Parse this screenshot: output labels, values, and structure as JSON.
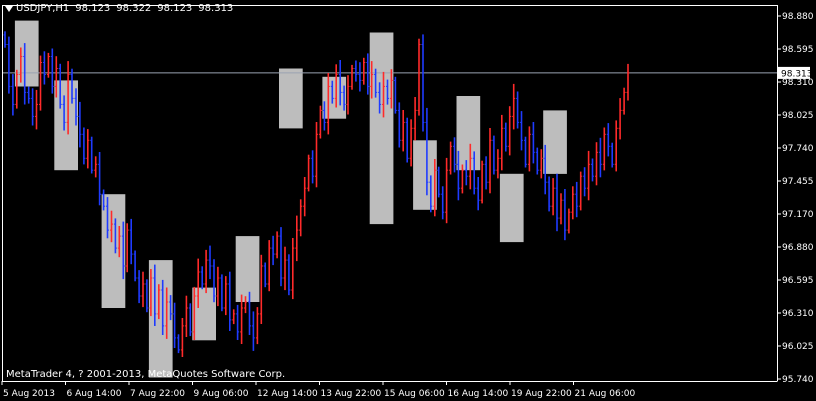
{
  "header": {
    "symbol": "USDJPY,H1",
    "open": "98.123",
    "high": "98.322",
    "low": "98.123",
    "close": "98.313"
  },
  "copyright": "MetaTrader 4, ? 2001-2013, MetaQuotes Software Corp.",
  "colors": {
    "background": "#000000",
    "axis": "#ffffff",
    "bull": "#ff2a2a",
    "bear": "#1f3bff",
    "highlight_box": "#bdbdbd",
    "bid_line": "#9aa3b2",
    "price_tag_bg": "#ffffff"
  },
  "chart_data": {
    "type": "bar",
    "symbol": "USDJPY",
    "timeframe": "H1",
    "ylim": [
      95.74,
      98.88
    ],
    "y_ticks": [
      "98.880",
      "98.595",
      "98.310",
      "98.025",
      "97.740",
      "97.455",
      "97.170",
      "96.880",
      "96.595",
      "96.310",
      "96.025",
      "95.740"
    ],
    "x_ticks": [
      "5 Aug 2013",
      "6 Aug 14:00",
      "7 Aug 22:00",
      "9 Aug 06:00",
      "12 Aug 14:00",
      "13 Aug 22:00",
      "15 Aug 06:00",
      "16 Aug 14:00",
      "19 Aug 22:00",
      "21 Aug 06:00"
    ],
    "current_price": "98.313",
    "closes": [
      98.55,
      98.2,
      98.05,
      98.3,
      98.45,
      98.15,
      98.1,
      97.95,
      98.05,
      98.4,
      98.3,
      98.45,
      98.2,
      98.35,
      98.05,
      97.9,
      98.3,
      98.1,
      97.95,
      97.8,
      97.6,
      97.75,
      97.5,
      97.55,
      97.3,
      97.2,
      97.0,
      97.05,
      96.85,
      96.95,
      96.7,
      97.0,
      96.8,
      96.6,
      96.45,
      96.55,
      96.35,
      96.6,
      96.3,
      96.5,
      96.2,
      96.4,
      96.3,
      96.1,
      96.0,
      96.2,
      96.35,
      96.15,
      96.45,
      96.65,
      96.55,
      96.75,
      96.7,
      96.45,
      96.6,
      96.35,
      96.55,
      96.25,
      96.3,
      96.15,
      96.35,
      96.4,
      96.2,
      96.1,
      96.3,
      96.7,
      96.55,
      96.85,
      96.8,
      96.95,
      96.6,
      96.75,
      96.5,
      96.85,
      97.0,
      97.2,
      97.35,
      97.6,
      97.45,
      97.8,
      98.0,
      97.9,
      98.2,
      98.1,
      98.3,
      98.15,
      98.05,
      98.2,
      98.35,
      98.3,
      98.25,
      98.4,
      98.2,
      98.3,
      98.15,
      98.05,
      98.2,
      98.1,
      98.25,
      98.0,
      97.75,
      97.9,
      97.6,
      97.85,
      98.0,
      98.55,
      97.9,
      97.4,
      97.2,
      97.5,
      97.3,
      97.15,
      97.5,
      97.7,
      97.55,
      97.35,
      97.5,
      97.45,
      97.6,
      97.35,
      97.25,
      97.55,
      97.4,
      97.75,
      97.5,
      97.6,
      97.85,
      97.7,
      97.95,
      98.1,
      97.9,
      97.75,
      97.55,
      97.8,
      97.65,
      97.5,
      97.6,
      97.4,
      97.2,
      97.35,
      97.1,
      97.25,
      97.0,
      97.15,
      97.3,
      97.2,
      97.45,
      97.35,
      97.55,
      97.45,
      97.65,
      97.55,
      97.8,
      97.7,
      97.55,
      97.85,
      98.0,
      98.15,
      98.313
    ],
    "highlight_ranges": [
      {
        "from": 3,
        "to": 8,
        "high": 98.75,
        "low": 98.2
      },
      {
        "from": 13,
        "to": 18,
        "high": 98.25,
        "low": 97.5
      },
      {
        "from": 25,
        "to": 30,
        "high": 97.3,
        "low": 96.35
      },
      {
        "from": 37,
        "to": 42,
        "high": 96.75,
        "low": 95.77
      },
      {
        "from": 48,
        "to": 53,
        "high": 96.52,
        "low": 96.08
      },
      {
        "from": 59,
        "to": 64,
        "high": 96.95,
        "low": 96.4
      },
      {
        "from": 70,
        "to": 75,
        "high": 98.35,
        "low": 97.85
      },
      {
        "from": 81,
        "to": 86,
        "high": 98.28,
        "low": 97.93
      },
      {
        "from": 93,
        "to": 98,
        "high": 98.65,
        "low": 97.05
      },
      {
        "from": 104,
        "to": 109,
        "high": 97.75,
        "low": 97.17
      },
      {
        "from": 115,
        "to": 120,
        "high": 98.12,
        "low": 97.5
      },
      {
        "from": 126,
        "to": 131,
        "high": 97.47,
        "low": 96.9
      },
      {
        "from": 137,
        "to": 142,
        "high": 98.0,
        "low": 97.47
      }
    ]
  }
}
